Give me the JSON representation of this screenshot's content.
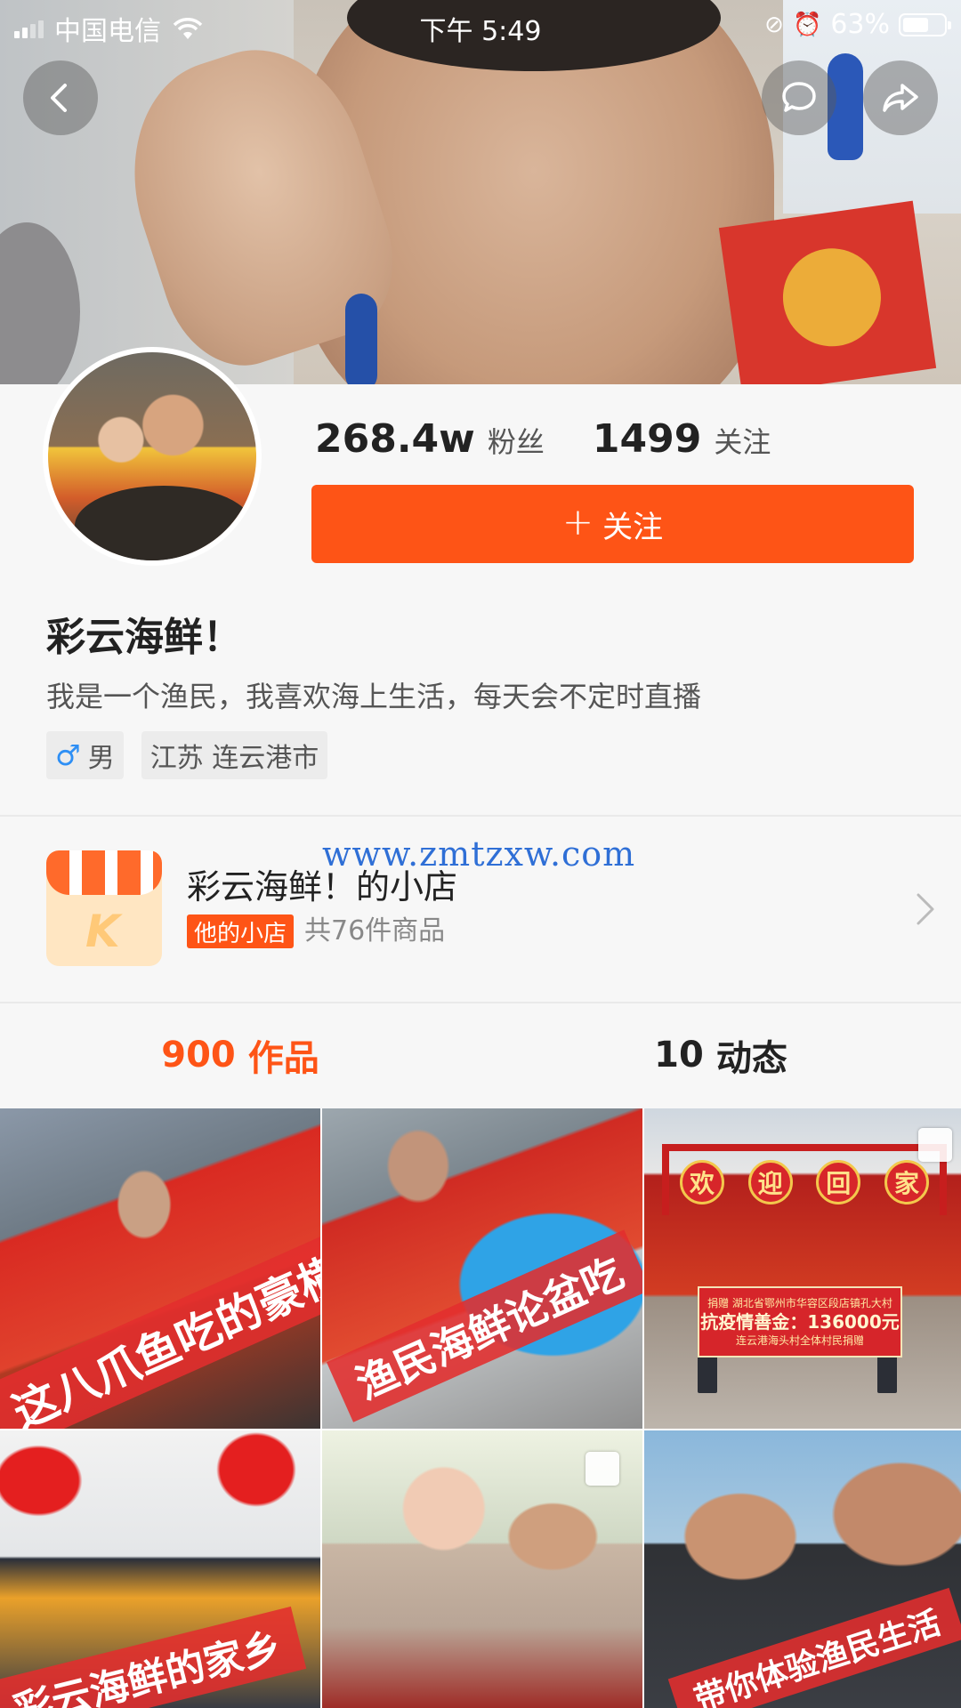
{
  "status_bar": {
    "carrier": "中国电信",
    "time": "下午 5:49",
    "battery": "63%",
    "battery_level": 0.63
  },
  "header": {
    "icons": [
      "back-icon",
      "chat-bubble-icon",
      "share-icon"
    ]
  },
  "profile": {
    "fans_count": "268.4w",
    "fans_label": "粉丝",
    "following_count": "1499",
    "following_label": "关注",
    "follow_plus": "+",
    "follow_button_label": "关注",
    "nickname": "彩云海鲜！",
    "bio": "我是一个渔民，我喜欢海上生活，每天会不定时直播",
    "gender_symbol": "♂",
    "gender": "男",
    "location": "江苏 连云港市"
  },
  "shop": {
    "icon_letter": "K",
    "title": "彩云海鲜！的小店",
    "badge": "他的小店",
    "count": "共76件商品"
  },
  "watermark": "www.zmtzxw.com",
  "tabs": [
    {
      "count": "900",
      "label": "作品",
      "active": true
    },
    {
      "count": "10",
      "label": "动态",
      "active": false
    }
  ],
  "videos": [
    {
      "caption": "这八爪鱼吃的豪横"
    },
    {
      "caption": "渔民海鲜论盆吃"
    },
    {
      "caption": "",
      "arch_chars": [
        "欢",
        "迎",
        "回",
        "家"
      ],
      "sign_line1": "捐赠 湖北省鄂州市华容区段店镇孔大村",
      "sign_line2": "抗疫情善金：136000元",
      "sign_line3": "连云港海头村全体村民捐赠"
    },
    {
      "caption": "彩云海鲜的家乡"
    },
    {
      "caption": ""
    },
    {
      "caption": "带你体验渔民生活"
    }
  ],
  "colors": {
    "accent": "#fe5416",
    "male_icon": "#2e8ff5",
    "watermark": "#2f6fd6",
    "banner": "#e22d2d"
  }
}
